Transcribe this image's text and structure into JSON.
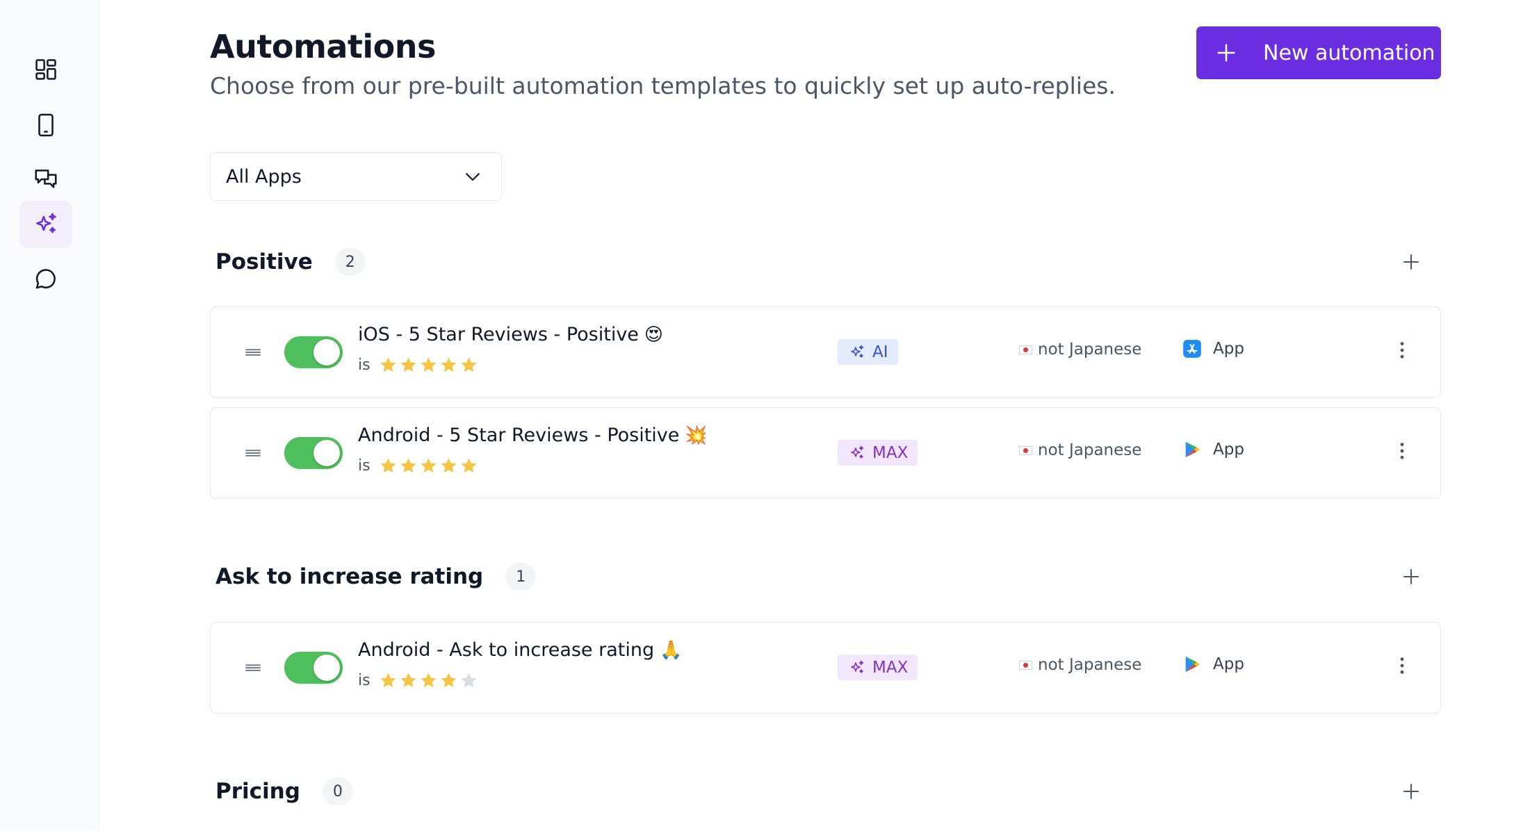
{
  "header": {
    "title": "Automations",
    "subtitle": "Choose from our pre-built automation templates to quickly set up auto-replies.",
    "new_button_label": "New automation"
  },
  "filter": {
    "selected": "All Apps"
  },
  "sidebar": {
    "items": [
      {
        "icon": "dashboard-icon",
        "active": false
      },
      {
        "icon": "device-icon",
        "active": false
      },
      {
        "icon": "messages-icon",
        "active": false
      },
      {
        "icon": "sparkles-icon",
        "active": true
      },
      {
        "icon": "chat-bubble-icon",
        "active": false
      }
    ]
  },
  "sections": [
    {
      "title": "Positive",
      "count": "2",
      "automations": [
        {
          "title": "iOS - 5 Star Reviews - Positive",
          "emoji": "😍",
          "enabled": true,
          "condition": "is",
          "rating": 5,
          "model": "AI",
          "language": "not Japanese",
          "store": "app-store",
          "store_label": "App"
        },
        {
          "title": "Android - 5 Star Reviews - Positive",
          "emoji": "💥",
          "enabled": true,
          "condition": "is",
          "rating": 5,
          "model": "MAX",
          "language": "not Japanese",
          "store": "google-play",
          "store_label": "App"
        }
      ]
    },
    {
      "title": "Ask to increase rating",
      "count": "1",
      "automations": [
        {
          "title": "Android - Ask to increase rating",
          "emoji": "🙏",
          "enabled": true,
          "condition": "is",
          "rating": 4,
          "model": "MAX",
          "language": "not Japanese",
          "store": "google-play",
          "store_label": "App"
        }
      ]
    },
    {
      "title": "Pricing",
      "count": "0",
      "automations": []
    }
  ],
  "colors": {
    "primary": "#6b2ee0",
    "toggle_on": "#4fbe5c",
    "star_filled": "#f5c443",
    "star_empty": "#d9dbe0",
    "ai_badge_bg": "#e3ebfd",
    "max_badge_bg": "#f2e6fb"
  }
}
